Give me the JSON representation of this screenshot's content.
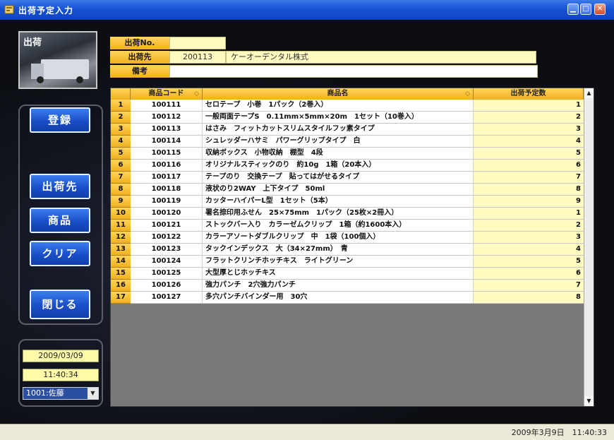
{
  "window": {
    "title": "出荷予定入力"
  },
  "logo": {
    "label": "出荷"
  },
  "nav": {
    "register": "登録",
    "destination": "出荷先",
    "product": "商品",
    "clear": "クリア",
    "close": "閉じる"
  },
  "status_panel": {
    "date": "2009/03/09",
    "time": "11:40:34",
    "user": "1001:佐藤"
  },
  "header_form": {
    "shipment_no_label": "出荷No.",
    "shipment_no_value": "",
    "destination_label": "出荷先",
    "destination_code": "200113",
    "destination_name": "ケーオーデンタル株式",
    "note_label": "備考",
    "note_value": ""
  },
  "grid": {
    "columns": {
      "code": "商品コード",
      "name": "商品名",
      "qty": "出荷予定数"
    },
    "rows": [
      {
        "num": "1",
        "code": "100111",
        "name": "セロテープ　小巻　1パック（2巻入）",
        "qty": "1"
      },
      {
        "num": "2",
        "code": "100112",
        "name": "一般両面テープS　0.11mm×5mm×20m　1セット（10巻入）",
        "qty": "2"
      },
      {
        "num": "3",
        "code": "100113",
        "name": "はさみ　フィットカットスリムスタイルフッ素タイプ",
        "qty": "3"
      },
      {
        "num": "4",
        "code": "100114",
        "name": "シュレッダーハサミ　パワーグリップタイプ　白",
        "qty": "4"
      },
      {
        "num": "5",
        "code": "100115",
        "name": "収納ボックス　小物収納　棚型　4段",
        "qty": "5"
      },
      {
        "num": "6",
        "code": "100116",
        "name": "オリジナルスティックのり　約10g　1箱（20本入）",
        "qty": "6"
      },
      {
        "num": "7",
        "code": "100117",
        "name": "テープのり　交換テープ　貼ってはがせるタイプ",
        "qty": "7"
      },
      {
        "num": "8",
        "code": "100118",
        "name": "液状のり2WAY　上下タイプ　50ml",
        "qty": "8"
      },
      {
        "num": "9",
        "code": "100119",
        "name": "カッターハイパーL型　1セット（5本）",
        "qty": "9"
      },
      {
        "num": "10",
        "code": "100120",
        "name": "署名捺印用ふせん　25×75mm　1パック（25枚×2冊入）",
        "qty": "1"
      },
      {
        "num": "11",
        "code": "100121",
        "name": "ストックバー入り　カラーゼムクリップ　1箱（約1600本入）",
        "qty": "2"
      },
      {
        "num": "12",
        "code": "100122",
        "name": "カラーアソートダブルクリップ　中　1袋（100個入）",
        "qty": "3"
      },
      {
        "num": "13",
        "code": "100123",
        "name": "タックインデックス　大（34×27mm）　青",
        "qty": "4"
      },
      {
        "num": "14",
        "code": "100124",
        "name": "フラットクリンチホッチキス　ライトグリーン",
        "qty": "5"
      },
      {
        "num": "15",
        "code": "100125",
        "name": "大型厚とじホッチキス",
        "qty": "6"
      },
      {
        "num": "16",
        "code": "100126",
        "name": "強力パンチ　2穴強力パンチ",
        "qty": "7"
      },
      {
        "num": "17",
        "code": "100127",
        "name": "多穴パンチバインダー用　30穴",
        "qty": "8"
      }
    ]
  },
  "statusbar": {
    "datetime": "2009年3月9日　11:40:33"
  }
}
